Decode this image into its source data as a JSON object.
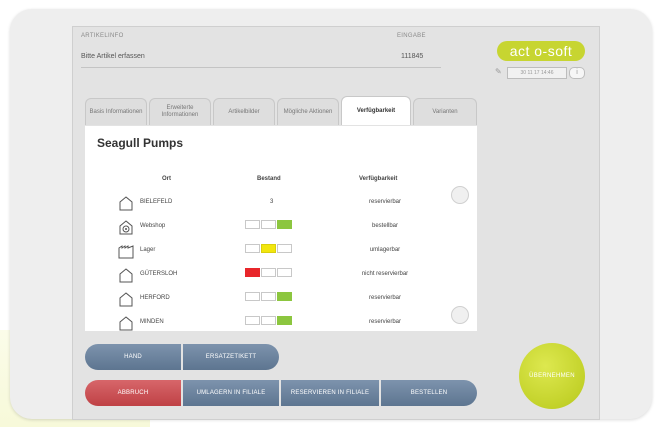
{
  "header": {
    "label_left": "ARTIKELINFO",
    "label_right": "EINGABE",
    "input_text": "Bitte Artikel erfassen",
    "input_number": "111845",
    "logo": "act o-soft",
    "user_text": "30 11 17 14:46",
    "info_label": "i"
  },
  "tabs": [
    {
      "label": "Basis Informationen"
    },
    {
      "label": "Erweiterte Informationen"
    },
    {
      "label": "Artikelbilder"
    },
    {
      "label": "Mögliche Aktionen"
    },
    {
      "label": "Verfügbarkeit"
    },
    {
      "label": "Varianten"
    }
  ],
  "content": {
    "title": "Seagull Pumps",
    "headers": {
      "ort": "Ort",
      "bestand": "Bestand",
      "verfuegbarkeit": "Verfügbarkeit"
    },
    "rows": [
      {
        "name": "BIELEFELD",
        "icon": "house-icon",
        "stock_text": "3",
        "stock_cells": [],
        "status": "reservierbar"
      },
      {
        "name": "Webshop",
        "icon": "webshop-icon",
        "stock_text": "",
        "stock_cells": [
          "empty",
          "empty",
          "green"
        ],
        "status": "bestellbar"
      },
      {
        "name": "Lager",
        "icon": "warehouse-icon",
        "stock_text": "",
        "stock_cells": [
          "empty",
          "yellow",
          "empty"
        ],
        "status": "umlagerbar"
      },
      {
        "name": "GÜTERSLOH",
        "icon": "house-icon",
        "stock_text": "",
        "stock_cells": [
          "red",
          "empty",
          "empty"
        ],
        "status": "nicht reservierbar"
      },
      {
        "name": "HERFORD",
        "icon": "house-icon",
        "stock_text": "",
        "stock_cells": [
          "empty",
          "empty",
          "green"
        ],
        "status": "reservierbar"
      },
      {
        "name": "MINDEN",
        "icon": "house-icon",
        "stock_text": "",
        "stock_cells": [
          "empty",
          "empty",
          "green"
        ],
        "status": "reservierbar"
      }
    ]
  },
  "buttons": {
    "hand": "HAND",
    "ersatzetikett": "ERSATZETIKETT",
    "abbruch": "ABBRUCH",
    "umlagern": "UMLAGERN IN FILIALE",
    "reservieren": "RESERVIEREN IN FILIALE",
    "bestellen": "BESTELLEN",
    "uebernehmen": "ÜBERNEHMEN"
  },
  "colors": {
    "brand": "#c7d531",
    "button_blue": "#6b84a0",
    "button_red": "#c94b4f",
    "stock_green": "#8cc63f",
    "stock_yellow": "#f2e60d",
    "stock_red": "#e8262b"
  }
}
